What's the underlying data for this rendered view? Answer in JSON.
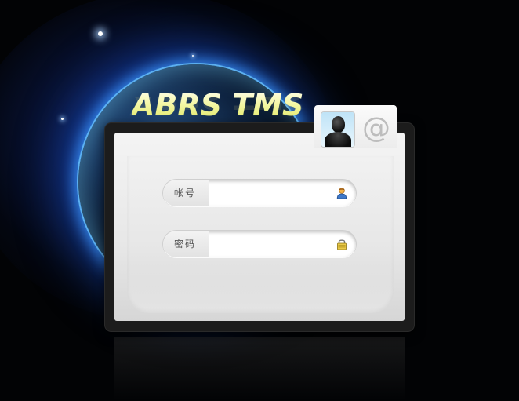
{
  "app": {
    "title": "ABRS TMS"
  },
  "login": {
    "account_label": "帐号",
    "account_value": "",
    "password_label": "密码",
    "password_value": "",
    "account_icon": "user-icon",
    "password_icon": "lock-icon",
    "avatar_icon": "avatar-silhouette-icon",
    "at_symbol": "@"
  },
  "colors": {
    "title_gradient_top": "#ffffff",
    "title_gradient_bottom": "#d9e44a",
    "panel_bg": "#ececec",
    "frame_bg": "#1c1c1c",
    "globe_glow": "#3c96ff"
  }
}
